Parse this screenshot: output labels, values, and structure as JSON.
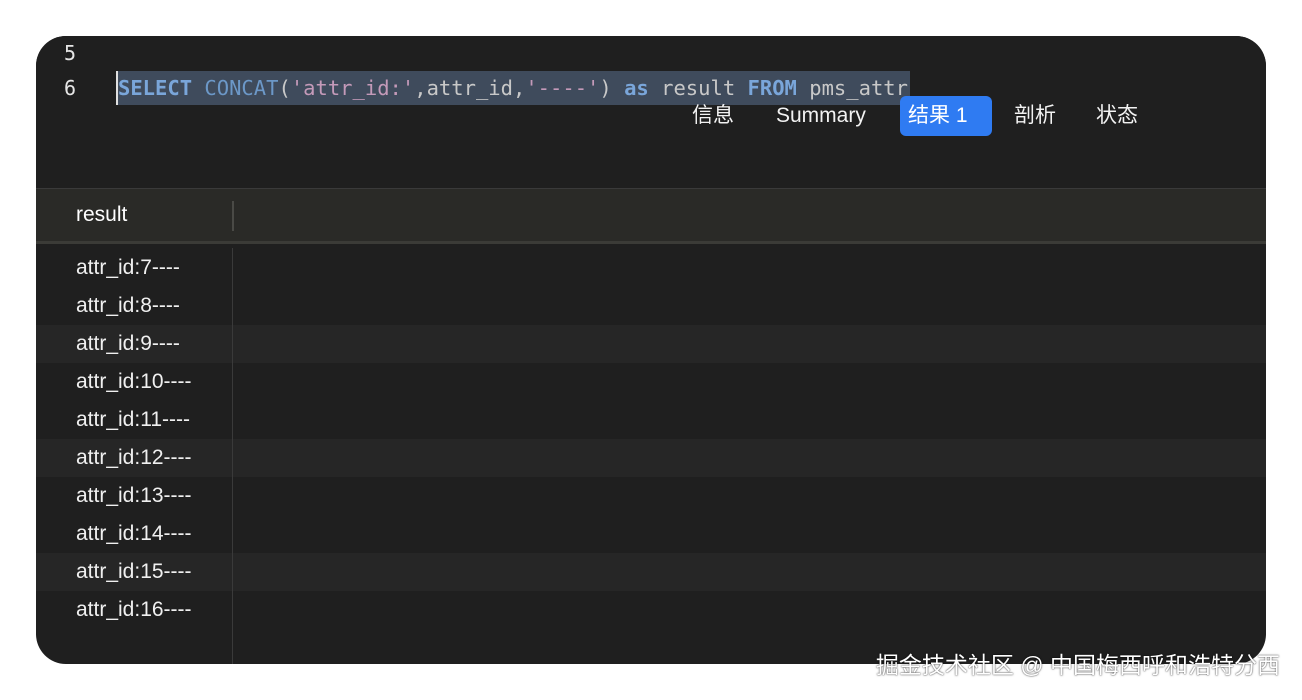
{
  "editor": {
    "lines": [
      {
        "number": "5",
        "code": []
      },
      {
        "number": "6",
        "code": [
          {
            "type": "kw",
            "text": "SELECT"
          },
          {
            "type": "op",
            "text": " "
          },
          {
            "type": "fn",
            "text": "CONCAT"
          },
          {
            "type": "op",
            "text": "("
          },
          {
            "type": "str",
            "text": "'attr_id:'"
          },
          {
            "type": "op",
            "text": ",attr_id,"
          },
          {
            "type": "str",
            "text": "'----'"
          },
          {
            "type": "op",
            "text": ") "
          },
          {
            "type": "kw",
            "text": "as"
          },
          {
            "type": "id",
            "text": " result "
          },
          {
            "type": "kw",
            "text": "FROM"
          },
          {
            "type": "id",
            "text": " pms_attr"
          }
        ]
      }
    ]
  },
  "tabs": [
    {
      "label": "信息",
      "active": false
    },
    {
      "label": "Summary",
      "active": false
    },
    {
      "label": "结果 1",
      "active": true
    },
    {
      "label": "剖析",
      "active": false
    },
    {
      "label": "状态",
      "active": false
    }
  ],
  "grid": {
    "columns": [
      "result"
    ],
    "rows": [
      "attr_id:7----",
      "attr_id:8----",
      "attr_id:9----",
      "attr_id:10----",
      "attr_id:11----",
      "attr_id:12----",
      "attr_id:13----",
      "attr_id:14----",
      "attr_id:15----",
      "attr_id:16----"
    ]
  },
  "watermark": "掘金技术社区 @ 中国梅西呼和浩特分西",
  "colors": {
    "accent": "#2f7bf2",
    "background": "#1f1f1f",
    "keyword": "#7aa6da",
    "string": "#c49ab9",
    "selection": "#3f4b5c"
  }
}
